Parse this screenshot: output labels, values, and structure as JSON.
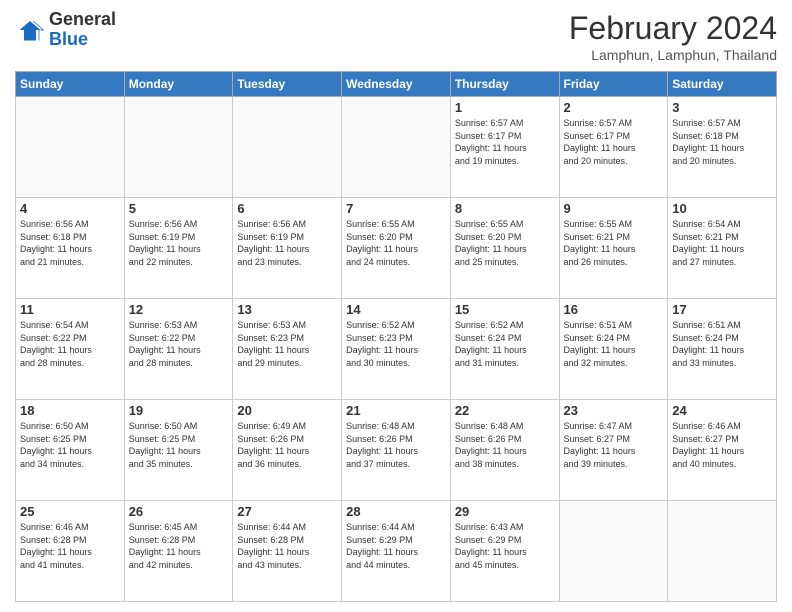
{
  "header": {
    "logo_general": "General",
    "logo_blue": "Blue",
    "month_title": "February 2024",
    "location": "Lamphun, Lamphun, Thailand"
  },
  "days_of_week": [
    "Sunday",
    "Monday",
    "Tuesday",
    "Wednesday",
    "Thursday",
    "Friday",
    "Saturday"
  ],
  "weeks": [
    [
      {
        "day": "",
        "info": ""
      },
      {
        "day": "",
        "info": ""
      },
      {
        "day": "",
        "info": ""
      },
      {
        "day": "",
        "info": ""
      },
      {
        "day": "1",
        "info": "Sunrise: 6:57 AM\nSunset: 6:17 PM\nDaylight: 11 hours\nand 19 minutes."
      },
      {
        "day": "2",
        "info": "Sunrise: 6:57 AM\nSunset: 6:17 PM\nDaylight: 11 hours\nand 20 minutes."
      },
      {
        "day": "3",
        "info": "Sunrise: 6:57 AM\nSunset: 6:18 PM\nDaylight: 11 hours\nand 20 minutes."
      }
    ],
    [
      {
        "day": "4",
        "info": "Sunrise: 6:56 AM\nSunset: 6:18 PM\nDaylight: 11 hours\nand 21 minutes."
      },
      {
        "day": "5",
        "info": "Sunrise: 6:56 AM\nSunset: 6:19 PM\nDaylight: 11 hours\nand 22 minutes."
      },
      {
        "day": "6",
        "info": "Sunrise: 6:56 AM\nSunset: 6:19 PM\nDaylight: 11 hours\nand 23 minutes."
      },
      {
        "day": "7",
        "info": "Sunrise: 6:55 AM\nSunset: 6:20 PM\nDaylight: 11 hours\nand 24 minutes."
      },
      {
        "day": "8",
        "info": "Sunrise: 6:55 AM\nSunset: 6:20 PM\nDaylight: 11 hours\nand 25 minutes."
      },
      {
        "day": "9",
        "info": "Sunrise: 6:55 AM\nSunset: 6:21 PM\nDaylight: 11 hours\nand 26 minutes."
      },
      {
        "day": "10",
        "info": "Sunrise: 6:54 AM\nSunset: 6:21 PM\nDaylight: 11 hours\nand 27 minutes."
      }
    ],
    [
      {
        "day": "11",
        "info": "Sunrise: 6:54 AM\nSunset: 6:22 PM\nDaylight: 11 hours\nand 28 minutes."
      },
      {
        "day": "12",
        "info": "Sunrise: 6:53 AM\nSunset: 6:22 PM\nDaylight: 11 hours\nand 28 minutes."
      },
      {
        "day": "13",
        "info": "Sunrise: 6:53 AM\nSunset: 6:23 PM\nDaylight: 11 hours\nand 29 minutes."
      },
      {
        "day": "14",
        "info": "Sunrise: 6:52 AM\nSunset: 6:23 PM\nDaylight: 11 hours\nand 30 minutes."
      },
      {
        "day": "15",
        "info": "Sunrise: 6:52 AM\nSunset: 6:24 PM\nDaylight: 11 hours\nand 31 minutes."
      },
      {
        "day": "16",
        "info": "Sunrise: 6:51 AM\nSunset: 6:24 PM\nDaylight: 11 hours\nand 32 minutes."
      },
      {
        "day": "17",
        "info": "Sunrise: 6:51 AM\nSunset: 6:24 PM\nDaylight: 11 hours\nand 33 minutes."
      }
    ],
    [
      {
        "day": "18",
        "info": "Sunrise: 6:50 AM\nSunset: 6:25 PM\nDaylight: 11 hours\nand 34 minutes."
      },
      {
        "day": "19",
        "info": "Sunrise: 6:50 AM\nSunset: 6:25 PM\nDaylight: 11 hours\nand 35 minutes."
      },
      {
        "day": "20",
        "info": "Sunrise: 6:49 AM\nSunset: 6:26 PM\nDaylight: 11 hours\nand 36 minutes."
      },
      {
        "day": "21",
        "info": "Sunrise: 6:48 AM\nSunset: 6:26 PM\nDaylight: 11 hours\nand 37 minutes."
      },
      {
        "day": "22",
        "info": "Sunrise: 6:48 AM\nSunset: 6:26 PM\nDaylight: 11 hours\nand 38 minutes."
      },
      {
        "day": "23",
        "info": "Sunrise: 6:47 AM\nSunset: 6:27 PM\nDaylight: 11 hours\nand 39 minutes."
      },
      {
        "day": "24",
        "info": "Sunrise: 6:46 AM\nSunset: 6:27 PM\nDaylight: 11 hours\nand 40 minutes."
      }
    ],
    [
      {
        "day": "25",
        "info": "Sunrise: 6:46 AM\nSunset: 6:28 PM\nDaylight: 11 hours\nand 41 minutes."
      },
      {
        "day": "26",
        "info": "Sunrise: 6:45 AM\nSunset: 6:28 PM\nDaylight: 11 hours\nand 42 minutes."
      },
      {
        "day": "27",
        "info": "Sunrise: 6:44 AM\nSunset: 6:28 PM\nDaylight: 11 hours\nand 43 minutes."
      },
      {
        "day": "28",
        "info": "Sunrise: 6:44 AM\nSunset: 6:29 PM\nDaylight: 11 hours\nand 44 minutes."
      },
      {
        "day": "29",
        "info": "Sunrise: 6:43 AM\nSunset: 6:29 PM\nDaylight: 11 hours\nand 45 minutes."
      },
      {
        "day": "",
        "info": ""
      },
      {
        "day": "",
        "info": ""
      }
    ]
  ]
}
